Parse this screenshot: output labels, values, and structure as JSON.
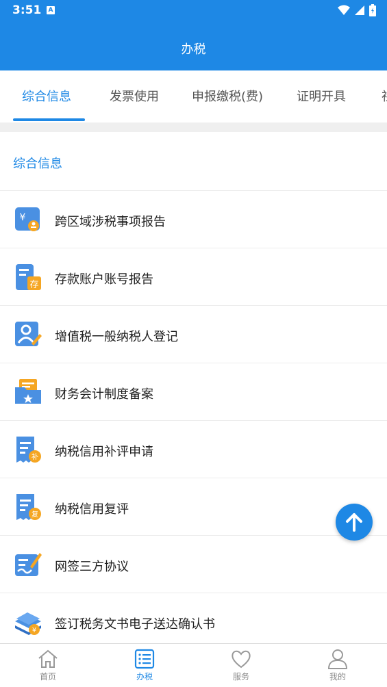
{
  "status_bar": {
    "time": "3:51",
    "notif_letter": "A"
  },
  "app_bar": {
    "title": "办税"
  },
  "tabs": [
    {
      "label": "综合信息",
      "active": true
    },
    {
      "label": "发票使用",
      "active": false
    },
    {
      "label": "申报缴税(费)",
      "active": false
    },
    {
      "label": "证明开具",
      "active": false
    },
    {
      "label": "社",
      "active": false
    }
  ],
  "section": {
    "title": "综合信息"
  },
  "items": [
    {
      "label": "跨区域涉税事项报告",
      "icon": "cross-region-report-icon"
    },
    {
      "label": "存款账户账号报告",
      "icon": "deposit-account-icon"
    },
    {
      "label": "增值税一般纳税人登记",
      "icon": "vat-taxpayer-registration-icon"
    },
    {
      "label": "财务会计制度备案",
      "icon": "accounting-system-filing-icon"
    },
    {
      "label": "纳税信用补评申请",
      "icon": "credit-supplementary-rating-icon"
    },
    {
      "label": "纳税信用复评",
      "icon": "credit-re-rating-icon"
    },
    {
      "label": "网签三方协议",
      "icon": "online-tripartite-agreement-icon"
    },
    {
      "label": "签订税务文书电子送达确认书",
      "icon": "electronic-delivery-confirmation-icon"
    }
  ],
  "icon_badges": {
    "deposit": "存",
    "supplement": "补",
    "rerate": "复",
    "yen": "¥"
  },
  "bottom_nav": [
    {
      "label": "首页",
      "icon": "home-icon",
      "active": false
    },
    {
      "label": "办税",
      "icon": "list-icon",
      "active": true
    },
    {
      "label": "服务",
      "icon": "heart-icon",
      "active": false
    },
    {
      "label": "我的",
      "icon": "user-icon",
      "active": false
    }
  ],
  "colors": {
    "primary": "#1e88e5",
    "icon_blue": "#3d8ef0",
    "icon_orange": "#f5a623",
    "divider": "#ececec"
  }
}
